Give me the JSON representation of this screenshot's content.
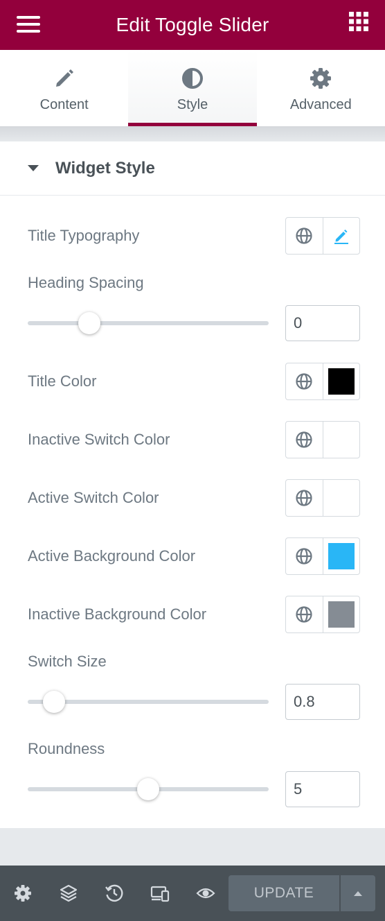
{
  "header": {
    "title": "Edit Toggle Slider",
    "menu_icon": "hamburger-icon",
    "apps_icon": "grid-icon",
    "brand_color": "#93003c"
  },
  "tabs": [
    {
      "label": "Content",
      "icon": "pencil-icon",
      "active": false
    },
    {
      "label": "Style",
      "icon": "contrast-icon",
      "active": true
    },
    {
      "label": "Advanced",
      "icon": "gear-icon",
      "active": false
    }
  ],
  "section": {
    "title": "Widget Style",
    "expanded": true
  },
  "controls": {
    "title_typography": {
      "label": "Title Typography",
      "icon": "globe-icon",
      "edit_icon": "pencil-edit-icon"
    },
    "heading_spacing": {
      "label": "Heading Spacing",
      "value": "0",
      "slider_fraction": 0.23
    },
    "title_color": {
      "label": "Title Color",
      "color": "#000000"
    },
    "inactive_switch_color": {
      "label": "Inactive Switch Color",
      "color": "#ffffff"
    },
    "active_switch_color": {
      "label": "Active Switch Color",
      "color": "#ffffff"
    },
    "active_background_color": {
      "label": "Active Background Color",
      "color": "#29b6f6"
    },
    "inactive_background_color": {
      "label": "Inactive Background Color",
      "color": "#858c94"
    },
    "switch_size": {
      "label": "Switch Size",
      "value": "0.8",
      "slider_fraction": 0.07
    },
    "roundness": {
      "label": "Roundness",
      "value": "5",
      "slider_fraction": 0.5
    }
  },
  "footer": {
    "icons": [
      "settings-icon",
      "layers-icon",
      "history-icon",
      "responsive-icon",
      "preview-eye-icon"
    ],
    "update_label": "UPDATE"
  }
}
